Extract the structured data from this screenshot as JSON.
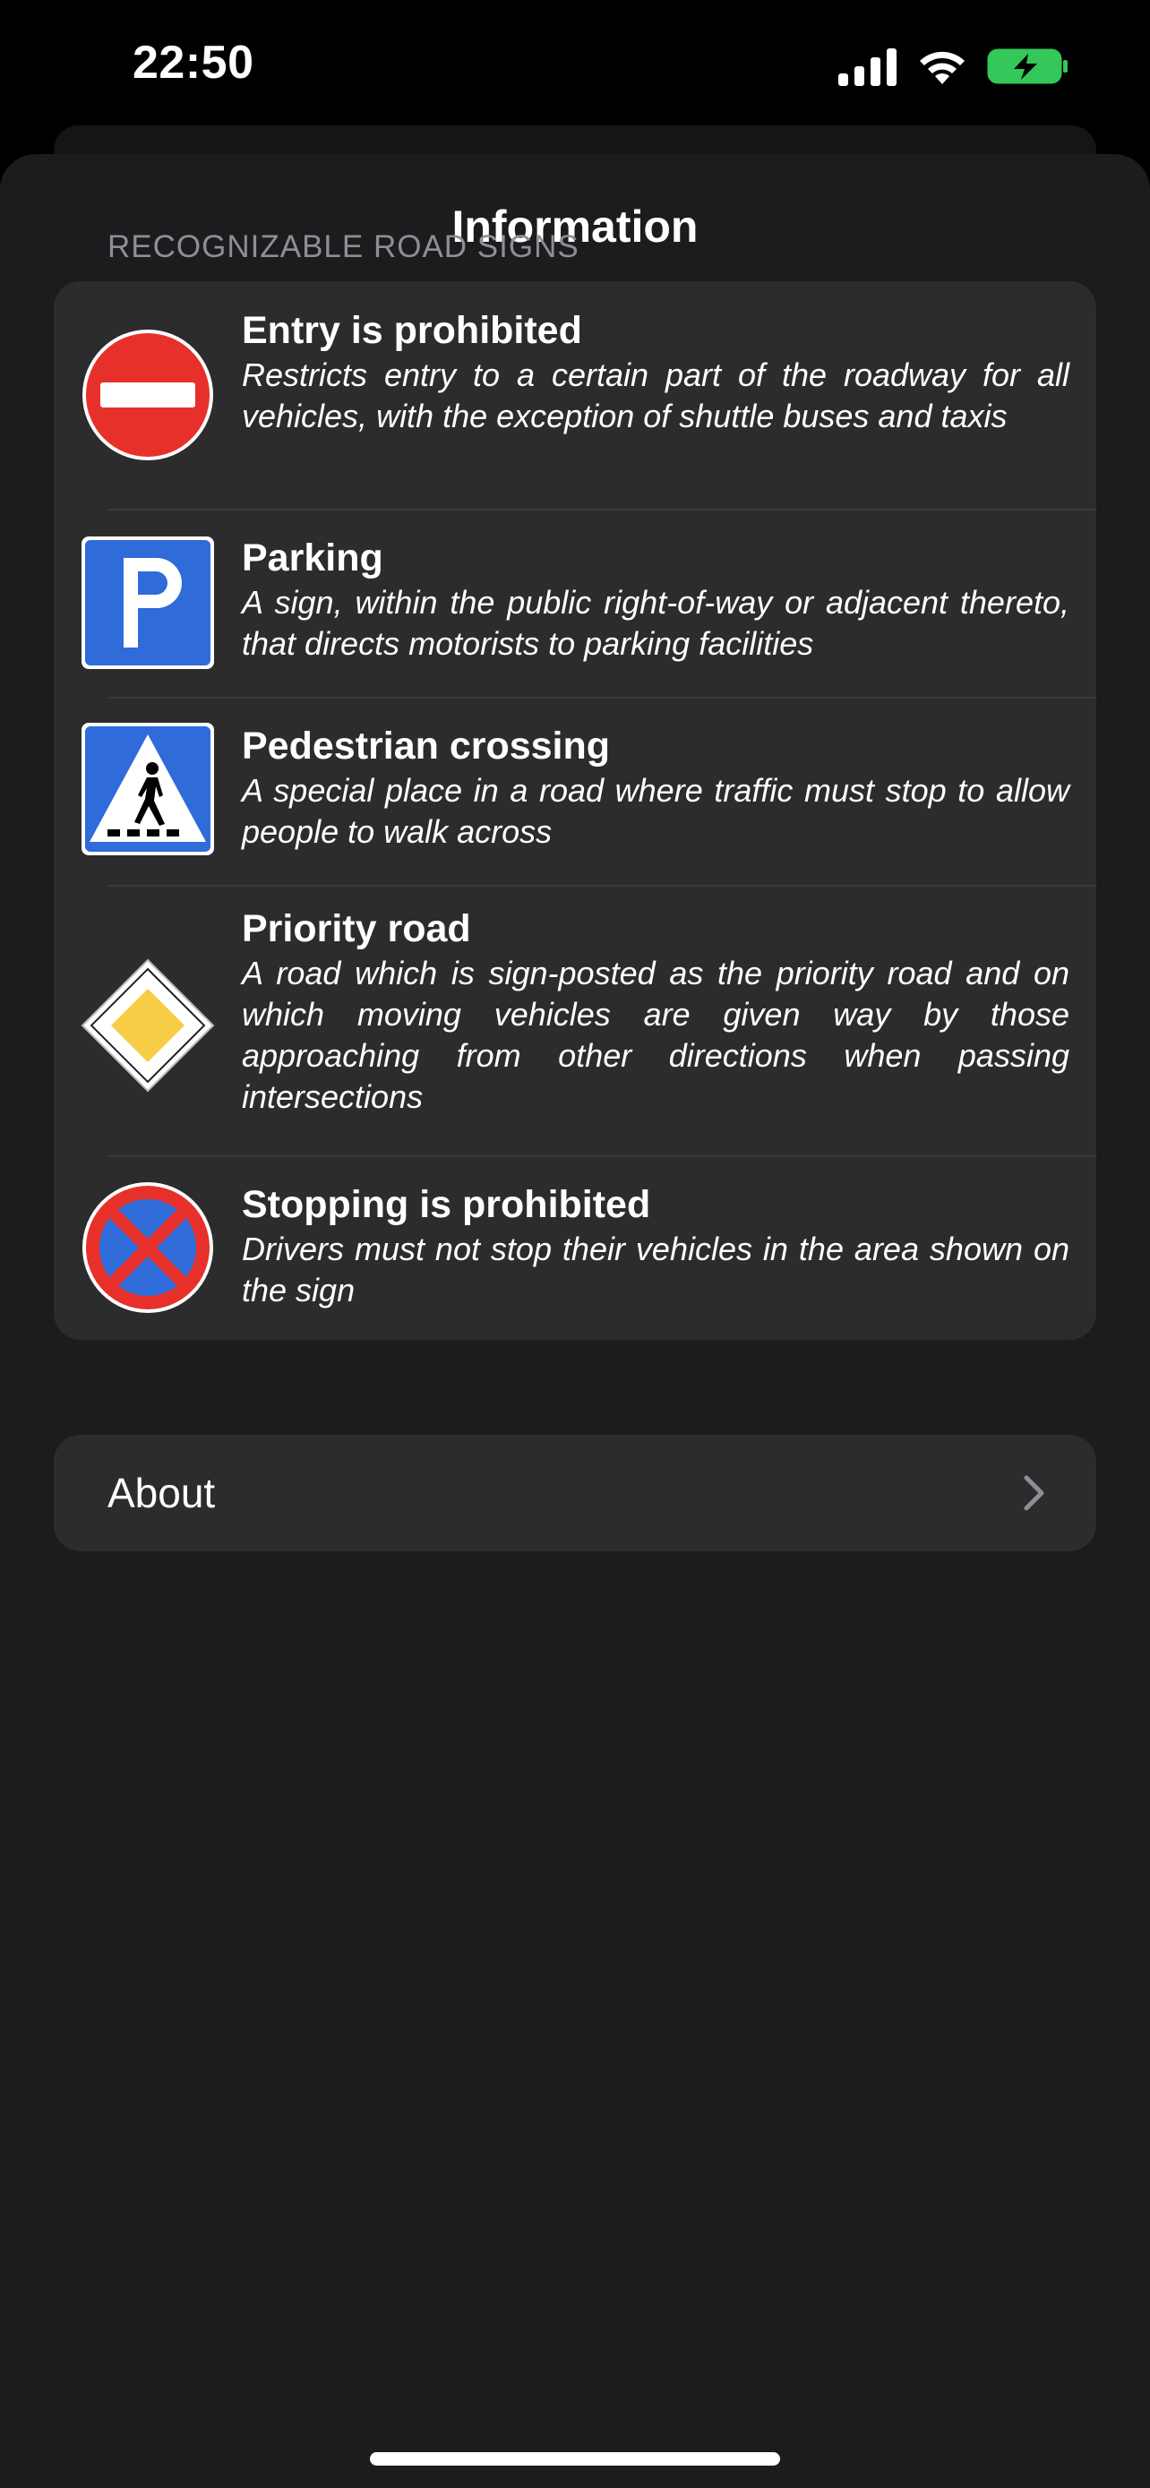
{
  "status_bar": {
    "time": "22:50",
    "icons": [
      "cellular-signal-icon",
      "wifi-icon",
      "battery-charging-icon"
    ],
    "battery_color": "#34c759"
  },
  "sheet": {
    "title": "Information"
  },
  "road_signs": {
    "header": "RECOGNIZABLE ROAD SIGNS",
    "items": [
      {
        "title": "Entry is prohibited",
        "description": "Restricts entry to a certain part of the roadway for all vehicles, with the exception of shuttle buses and taxis",
        "icon": "no-entry-sign-icon"
      },
      {
        "title": "Parking",
        "description": "A sign, within the public right-of-way or adjacent thereto, that directs motorists to parking facilities",
        "icon": "parking-sign-icon"
      },
      {
        "title": "Pedestrian crossing",
        "description": "A special place in a road where traffic must stop to allow people to walk across",
        "icon": "pedestrian-crossing-sign-icon"
      },
      {
        "title": "Priority road",
        "description": "A road which is sign-posted as the priority road and on which moving vehicles are given way by those approaching from other directions when passing intersections",
        "icon": "priority-road-sign-icon"
      },
      {
        "title": "Stopping is prohibited",
        "description": "Drivers must not stop their vehicles in the area shown on the sign",
        "icon": "no-stopping-sign-icon"
      }
    ]
  },
  "about": {
    "label": "About",
    "icon": "chevron-right-icon"
  },
  "colors": {
    "background": "#1c1c1e",
    "card": "#2c2c2e",
    "secondary_text": "#8e8e93",
    "sign_red": "#e8302a",
    "sign_blue": "#2f6bd9",
    "sign_yellow": "#f7cd46"
  }
}
